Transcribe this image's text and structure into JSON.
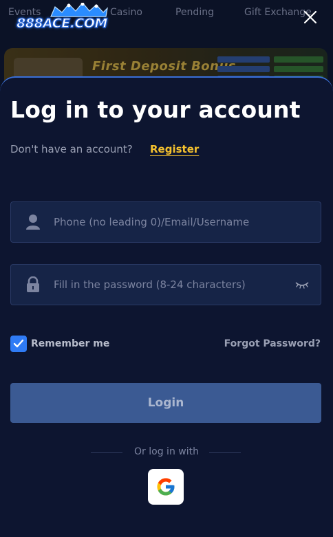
{
  "background": {
    "nav_items": [
      "Events",
      "Casino",
      "Pending",
      "Gift Exchange"
    ],
    "logo_text": "888ACE.COM",
    "banner_title": "First Deposit Bonus"
  },
  "modal": {
    "title": "Log in to your account",
    "no_account_text": "Don't have an account?",
    "register_label": "Register",
    "username_placeholder": "Phone (no leading 0)/Email/Username",
    "password_placeholder": "Fill in the password (8-24 characters)",
    "remember_label": "Remember me",
    "remember_checked": true,
    "forgot_label": "Forgot Password?",
    "login_label": "Login",
    "or_label": "Or log in with"
  },
  "colors": {
    "accent": "#2f7bf5",
    "link": "#f5c12e",
    "sheet_bg": "#0d1530",
    "button_bg": "#3b5a93"
  },
  "icons": {
    "close": "close-icon",
    "user": "user-icon",
    "lock": "lock-icon",
    "eye": "eye-closed-icon",
    "check": "check-icon",
    "google": "google-icon"
  }
}
